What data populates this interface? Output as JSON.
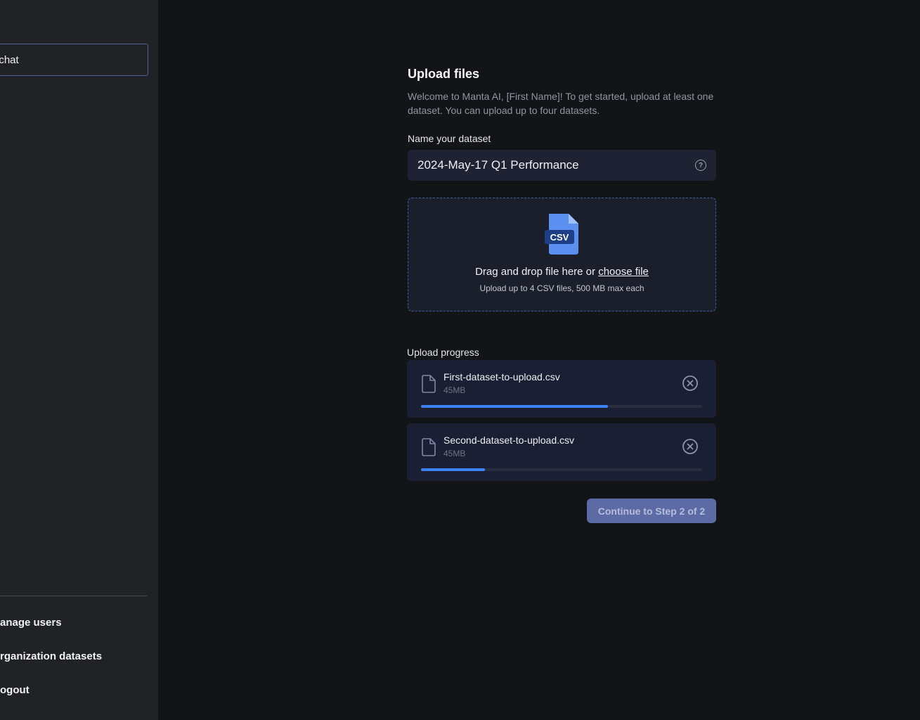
{
  "sidebar": {
    "new_chat_label": "ew chat",
    "items": [
      {
        "label": "anage users"
      },
      {
        "label": "rganization datasets"
      },
      {
        "label": "ogout"
      }
    ]
  },
  "main": {
    "title": "Upload files",
    "subtitle": "Welcome to Manta AI, [First Name]! To get started, upload at least one dataset. You can upload up to four datasets.",
    "dataset_name_label": "Name your dataset",
    "dataset_name_value": "2024-May-17 Q1 Performance",
    "dropzone": {
      "icon_label": "CSV",
      "text": "Drag and drop file here or ",
      "link": "choose file",
      "hint": "Upload up to 4 CSV files, 500 MB max each"
    },
    "progress_label": "Upload progress",
    "files": [
      {
        "name": "First-dataset-to-upload.csv",
        "size": "45MB",
        "progress": 0.665
      },
      {
        "name": "Second-dataset-to-upload.csv",
        "size": "45MB",
        "progress": 0.228
      }
    ],
    "continue_label": "Continue to Step 2 of 2"
  },
  "colors": {
    "sidebar_bg": "#202226",
    "page_bg": "#131418",
    "accent": "#3b82f6",
    "button_bg": "#5c6aa6"
  }
}
